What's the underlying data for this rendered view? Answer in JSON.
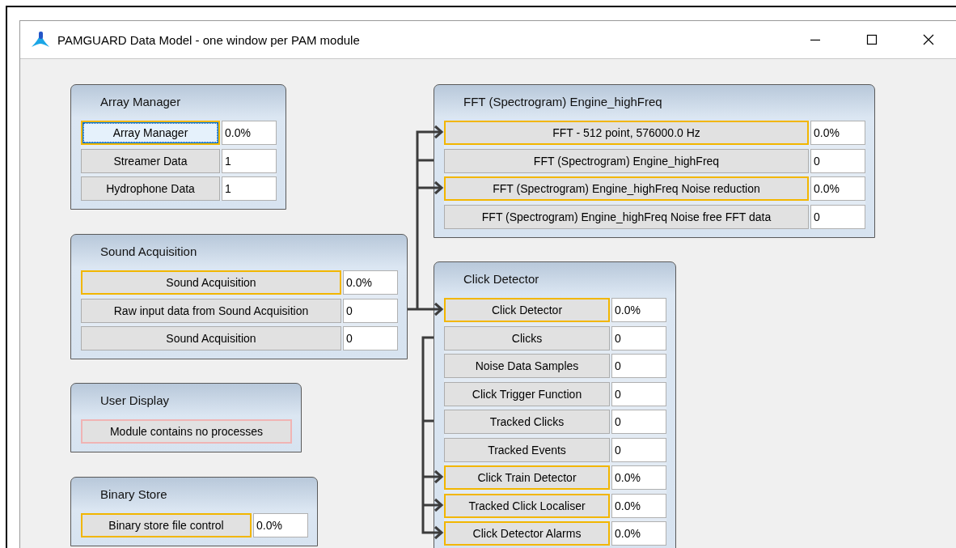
{
  "window": {
    "title": "PAMGUARD Data Model - one window per PAM module"
  },
  "modules": [
    {
      "title": "Array Manager",
      "rows": [
        {
          "kind": "process",
          "label": "Array Manager",
          "value": "0.0%",
          "focused": true
        },
        {
          "kind": "data",
          "label": "Streamer Data",
          "value": "1",
          "focused": false
        },
        {
          "kind": "data",
          "label": "Hydrophone Data",
          "value": "1",
          "focused": false
        }
      ]
    },
    {
      "title": "Sound Acquisition",
      "rows": [
        {
          "kind": "process",
          "label": "Sound Acquisition",
          "value": "0.0%",
          "focused": false
        },
        {
          "kind": "data",
          "label": "Raw input data from Sound Acquisition",
          "value": "0",
          "focused": false
        },
        {
          "kind": "data",
          "label": "Sound Acquisition",
          "value": "0",
          "focused": false
        }
      ]
    },
    {
      "title": "User Display",
      "rows": [
        {
          "kind": "empty",
          "label": "Module contains no processes",
          "focused": false
        }
      ]
    },
    {
      "title": "Binary Store",
      "rows": [
        {
          "kind": "process",
          "label": "Binary store file control",
          "value": "0.0%",
          "focused": false
        }
      ]
    },
    {
      "title": "FFT (Spectrogram) Engine_highFreq",
      "rows": [
        {
          "kind": "process",
          "label": "FFT - 512 point, 576000.0 Hz",
          "value": "0.0%",
          "focused": false
        },
        {
          "kind": "data",
          "label": "FFT (Spectrogram) Engine_highFreq",
          "value": "0",
          "focused": false
        },
        {
          "kind": "process",
          "label": "FFT (Spectrogram) Engine_highFreq Noise reduction",
          "value": "0.0%",
          "focused": false
        },
        {
          "kind": "data",
          "label": "FFT (Spectrogram) Engine_highFreq Noise free FFT data",
          "value": "0",
          "focused": false
        }
      ]
    },
    {
      "title": "Click Detector",
      "rows": [
        {
          "kind": "process",
          "label": "Click Detector",
          "value": "0.0%",
          "focused": false
        },
        {
          "kind": "data",
          "label": "Clicks",
          "value": "0",
          "focused": false
        },
        {
          "kind": "data",
          "label": "Noise Data Samples",
          "value": "0",
          "focused": false
        },
        {
          "kind": "data",
          "label": "Click Trigger Function",
          "value": "0",
          "focused": false
        },
        {
          "kind": "data",
          "label": "Tracked Clicks",
          "value": "0",
          "focused": false
        },
        {
          "kind": "data",
          "label": "Tracked Events",
          "value": "0",
          "focused": false
        },
        {
          "kind": "process",
          "label": "Click Train Detector",
          "value": "0.0%",
          "focused": false
        },
        {
          "kind": "process",
          "label": "Tracked Click Localiser",
          "value": "0.0%",
          "focused": false
        },
        {
          "kind": "process",
          "label": "Click Detector Alarms",
          "value": "0.0%",
          "focused": false
        }
      ]
    }
  ]
}
